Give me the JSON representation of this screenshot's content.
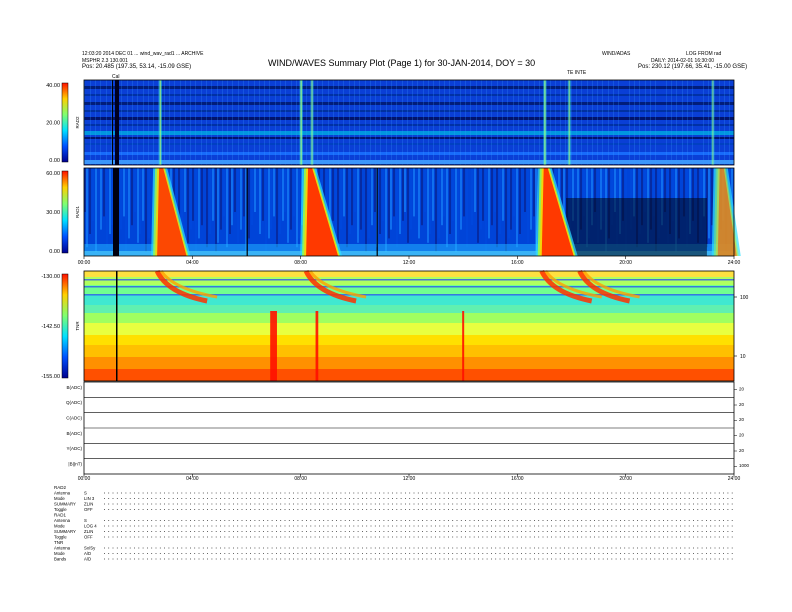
{
  "header": {
    "title": "WIND/WAVES Summary Plot (Page 1) for 30-JAN-2014, DOY = 30",
    "left_line1": "12:03:20 2014 DEC 01 ... wind_wav_rad1 ... ARCHIVE",
    "left_line2": "MSPHR 2.3 130.001",
    "left_pos": "Pos:   20.485 (197.35, 53.14, -15.09 GSE)",
    "right_line1a": "WIND/ADAS",
    "right_line1b": "LOG FROM rad",
    "right_line2": "DAILY: 2014-02-01 16:30:00",
    "right_pos": "Pos:   230.12 (197.66, 35.41, -15.00 GSE)",
    "cal_label": "Cal",
    "mid_label": "TE INTE"
  },
  "chart_data": [
    {
      "type": "heatmap",
      "panel": "RAD2",
      "ylabel": "RAD2",
      "yticks": [
        "40.00",
        "20.00",
        "0.00"
      ],
      "ylim": [
        0,
        40
      ],
      "features": [
        {
          "hour": 1.2,
          "strength": 1.0
        },
        {
          "hour": 2.8,
          "strength": 0.9
        },
        {
          "hour": 8.0,
          "strength": 1.0
        },
        {
          "hour": 8.4,
          "strength": 0.8
        },
        {
          "hour": 17.0,
          "strength": 1.0
        },
        {
          "hour": 17.9,
          "strength": 0.8
        },
        {
          "hour": 23.2,
          "strength": 0.7
        }
      ]
    },
    {
      "type": "heatmap",
      "panel": "RAD1",
      "ylabel": "RAD1",
      "yticks": [
        "60.00",
        "30.00",
        "0.00"
      ],
      "ylim": [
        0,
        60
      ],
      "xticks": [
        "00:00",
        "04:00",
        "08:00",
        "12:00",
        "16:00",
        "20:00",
        "24:00"
      ],
      "bursts": [
        {
          "hour": 2.7,
          "intensity": 0.9
        },
        {
          "hour": 8.2,
          "intensity": 1.0
        },
        {
          "hour": 16.9,
          "intensity": 1.0
        },
        {
          "hour": 23.4,
          "intensity": 0.5
        }
      ]
    },
    {
      "type": "heatmap",
      "panel": "TNR",
      "ylabel": "TNR",
      "yticks": [
        "-130.00",
        "-142.50",
        "-155.00"
      ],
      "ylim": [
        -155,
        -130
      ],
      "right_ticks": [
        "100",
        "10"
      ],
      "events": [
        {
          "hour": 7.0,
          "width": 0.25
        },
        {
          "hour": 8.6,
          "width": 0.1
        },
        {
          "hour": 14.0,
          "width": 0.05
        }
      ]
    },
    {
      "type": "line",
      "panel": "SWE/MFI",
      "rows": [
        {
          "label": "B(ADC)",
          "right": "20"
        },
        {
          "label": "Q(ADC)",
          "right": "20"
        },
        {
          "label": "C(ADC)",
          "right": "20"
        },
        {
          "label": "B(ADC)",
          "right": "20"
        },
        {
          "label": "Y(ADC)",
          "right": "20"
        },
        {
          "label": "|B|(nT)",
          "right": "1000"
        }
      ],
      "xticks": [
        "00:00",
        "04:00",
        "08:00",
        "12:00",
        "16:00",
        "20:00",
        "24:00"
      ]
    }
  ],
  "footer": {
    "rad2_title": "RAD2",
    "rad2_rows": [
      {
        "label": "Antenna",
        "value": "S"
      },
      {
        "label": "Mode",
        "value": "LIN 3"
      },
      {
        "label": "SUMMARY",
        "value": "ZLIN"
      },
      {
        "label": "Toggle",
        "value": "OFF"
      }
    ],
    "rad1_title": "RAD1",
    "rad1_rows": [
      {
        "label": "Antenna",
        "value": "S"
      },
      {
        "label": "Mode",
        "value": "LOG 4"
      },
      {
        "label": "SUMMARY",
        "value": "ZLIN"
      },
      {
        "label": "Toggle",
        "value": "OFF"
      }
    ],
    "tnr_title": "TNR",
    "tnr_rows": [
      {
        "label": "Antenna",
        "value": "Sx/Sy"
      },
      {
        "label": "Mode",
        "value": "A/D"
      },
      {
        "label": "Bands",
        "value": "A/D"
      }
    ]
  }
}
